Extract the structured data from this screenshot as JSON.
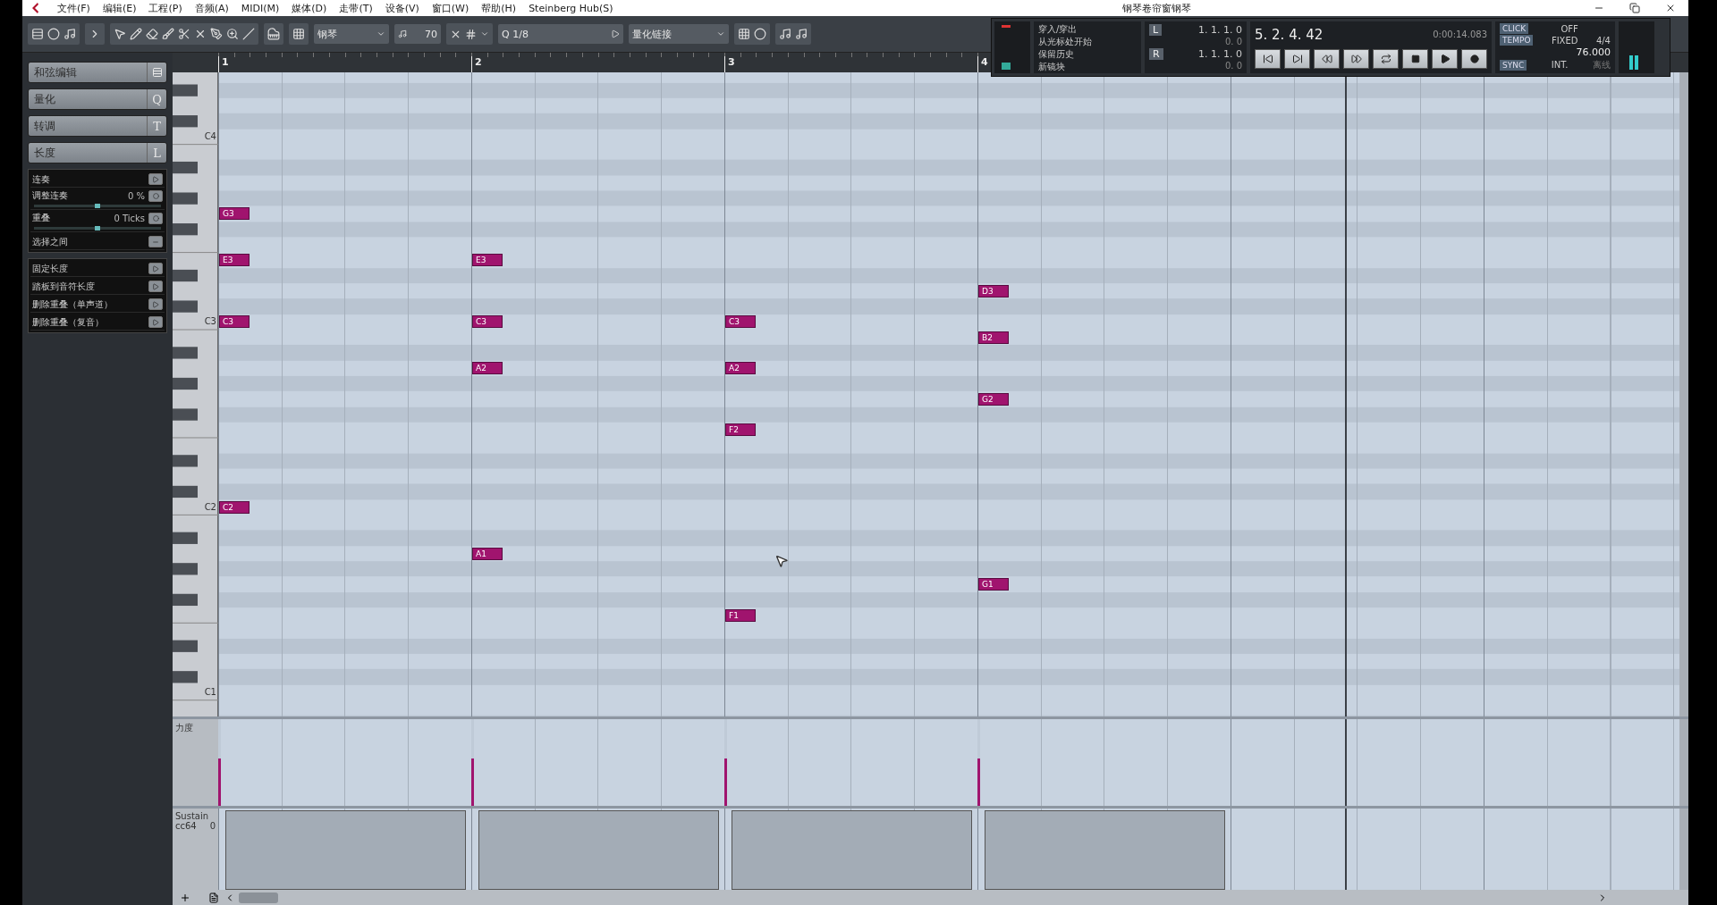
{
  "window": {
    "title": "钢琴卷帘窗钢琴"
  },
  "menu": [
    "文件(F)",
    "编辑(E)",
    "工程(P)",
    "音频(A)",
    "MIDI(M)",
    "媒体(D)",
    "走带(T)",
    "设备(V)",
    "窗口(W)",
    "帮助(H)",
    "Steinberg Hub(S)"
  ],
  "toolbar": {
    "track_dropdown": "钢琴",
    "velocity_field": "70",
    "quantize_label": "Q",
    "quantize_value": "1/8",
    "quantize_link": "量化链接"
  },
  "transport": {
    "modes": [
      "穿入/穿出",
      "从光标处开始",
      "保留历史",
      "新镜块"
    ],
    "locators": [
      {
        "label": "L",
        "position": "1. 1. 1.   0",
        "offset": "0.   0"
      },
      {
        "label": "R",
        "position": "1. 1. 1.   0",
        "offset": "0.   0"
      }
    ],
    "position": "5. 2. 4. 42",
    "time": "0:00:14.083",
    "click": {
      "label": "CLICK",
      "value": "OFF"
    },
    "tempo": {
      "label": "TEMPO",
      "mode": "FIXED",
      "signature": "4/4",
      "bpm": "76.000"
    },
    "sync": {
      "label": "SYNC",
      "value": "INT.",
      "status": "离线"
    }
  },
  "left_panel": {
    "sections": [
      {
        "label": "和弦编辑"
      },
      {
        "label": "量化",
        "key": "Q"
      },
      {
        "label": "转调",
        "key": "T"
      },
      {
        "label": "长度",
        "key": "L"
      }
    ],
    "length_rows": [
      {
        "kind": "button",
        "label": "连奏"
      },
      {
        "kind": "slider",
        "label": "调整连奏",
        "value": "0 %",
        "level": 0.5
      },
      {
        "kind": "slider",
        "label": "重叠",
        "value": "0 Ticks",
        "level": 0.5
      },
      {
        "kind": "toggle",
        "label": "选择之间"
      }
    ],
    "length_actions": [
      "固定长度",
      "踏板到音符长度",
      "删除重叠（单声道）",
      "删除重叠（复音）"
    ]
  },
  "keyboard": {
    "labels": [
      "C4",
      "C3",
      "C2",
      "C1"
    ]
  },
  "bars": [
    {
      "label": "1",
      "velocity": {
        "level": 0.55
      },
      "notes": [
        {
          "name": "G3"
        },
        {
          "name": "E3"
        },
        {
          "name": "C3"
        },
        {
          "name": "C2"
        }
      ]
    },
    {
      "label": "2",
      "velocity": {
        "level": 0.55
      },
      "notes": [
        {
          "name": "E3"
        },
        {
          "name": "C3"
        },
        {
          "name": "A2"
        },
        {
          "name": "A1"
        }
      ]
    },
    {
      "label": "3",
      "velocity": {
        "level": 0.55
      },
      "notes": [
        {
          "name": "C3"
        },
        {
          "name": "A2"
        },
        {
          "name": "F2"
        },
        {
          "name": "F1"
        }
      ]
    },
    {
      "label": "4",
      "velocity": {
        "level": 0.55
      },
      "notes": [
        {
          "name": "D3"
        },
        {
          "name": "B2"
        },
        {
          "name": "G2"
        },
        {
          "name": "G1"
        }
      ]
    }
  ],
  "velocity_lane": {
    "label": "力度"
  },
  "sustain_lane": {
    "label": "Sustain",
    "controller": "cc64",
    "value": "0"
  }
}
